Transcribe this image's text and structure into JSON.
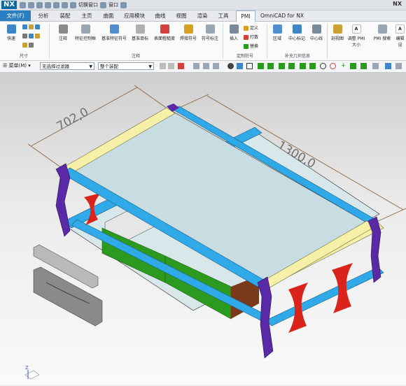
{
  "app": {
    "logo": "NX",
    "name": "NX"
  },
  "quick_access": {
    "switch_window": "切换窗口",
    "window": "窗口"
  },
  "tabs": [
    {
      "label": "文件(F)"
    },
    {
      "label": "分析"
    },
    {
      "label": "装配"
    },
    {
      "label": "主页"
    },
    {
      "label": "曲面"
    },
    {
      "label": "应用模块"
    },
    {
      "label": "曲线"
    },
    {
      "label": "视图"
    },
    {
      "label": "渲染"
    },
    {
      "label": "工具"
    },
    {
      "label": "PMI"
    },
    {
      "label": "OmniCAD for NX"
    }
  ],
  "ribbon": {
    "quick": "快速",
    "group_size": "尺寸",
    "annotation_buttons": [
      "注释",
      "特征控制框",
      "基准特征符号",
      "基准目标",
      "表面粗糙度",
      "焊接符号",
      "符号标注"
    ],
    "group_annotation": "注释",
    "insert": "插入",
    "define": "定义",
    "punch": "打散",
    "replace": "替换",
    "group_custom": "定制符号",
    "region": "区域",
    "center_mark": "中心标记",
    "center_line": "中心线",
    "group_supplement": "补充几何信息",
    "section_view": "剖视图",
    "adjust_pmi": "调整 PMI",
    "size_sub": "大小",
    "pmi_search": "PMI 搜索",
    "edit": "编辑设"
  },
  "toolbar": {
    "menu": "菜单(M)",
    "filter_select": "无选择过滤器",
    "assembly_select": "整个装配"
  },
  "viewport": {
    "dim_width": "702,0",
    "dim_length": "1300,0",
    "triad_z": "Z"
  },
  "colors": {
    "tube_blue": "#2fa9e8",
    "corner_purple": "#5a2aa6",
    "cream": "#f7f0a8",
    "leg_red": "#d9231b",
    "drawer_green": "#2b9a1e",
    "glass": "#c7dde2",
    "part_gray": "#8a8a8a",
    "dim_brown": "#8a6544",
    "file_tab": "#2b7fc1"
  }
}
